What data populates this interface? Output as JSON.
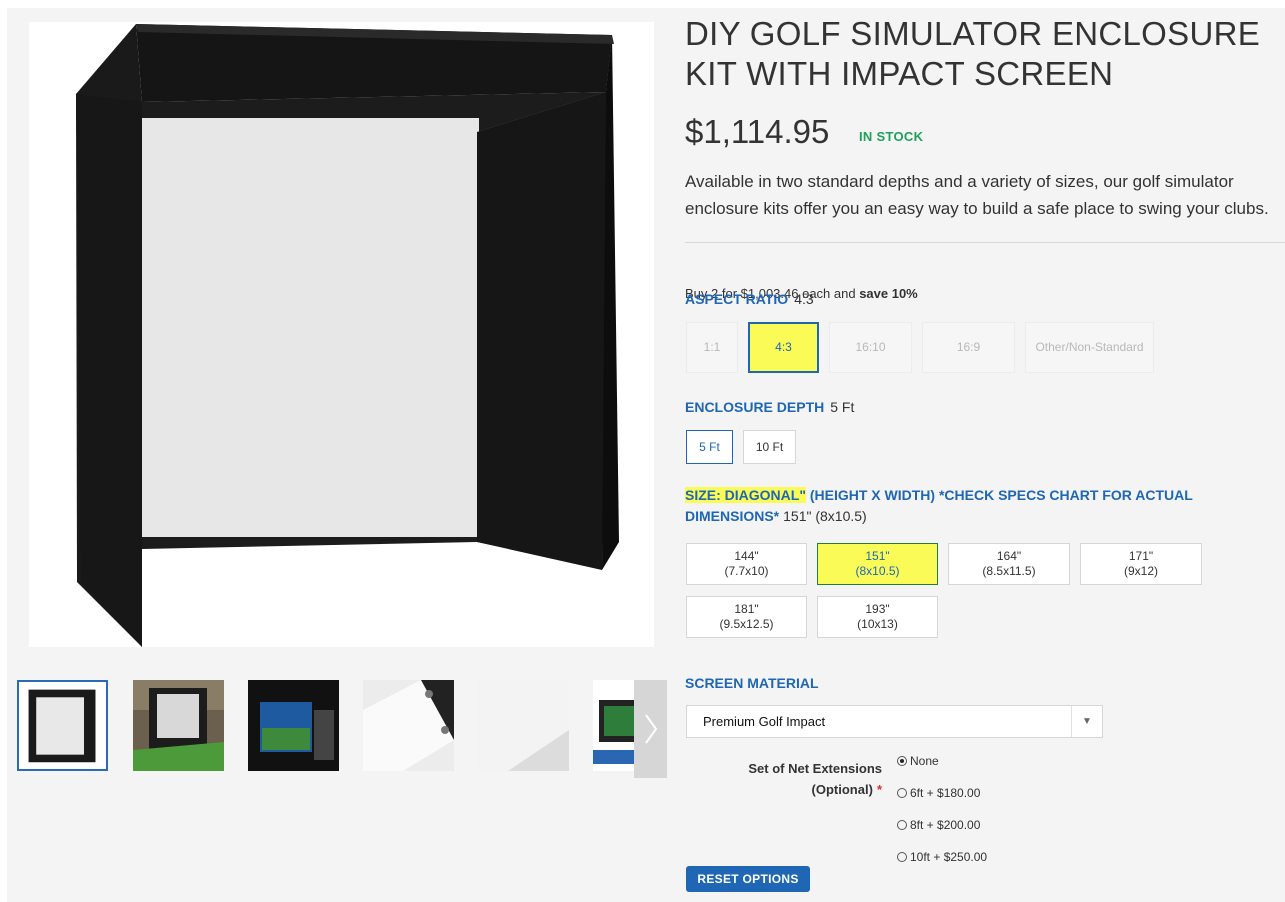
{
  "product": {
    "title": "DIY GOLF SIMULATOR ENCLOSURE KIT WITH IMPACT SCREEN",
    "price": "$1,114.95",
    "stock": "IN STOCK",
    "description": "Available in two standard depths and a variety of sizes, our golf simulator enclosure kits offer you an easy way to build a safe place to swing your clubs.",
    "tier_price": {
      "prefix": "Buy 2 for $1,003.46 each and ",
      "bold": "save 10%"
    }
  },
  "gallery": {
    "thumbnails": [
      "enclosure-front",
      "enclosure-room-turf",
      "enclosure-projection",
      "screen-corner-grommets",
      "screen-fabric-closeup",
      "enclosure-net-extension"
    ]
  },
  "aspect_ratio": {
    "label": "ASPECT RATIO",
    "selected": "4:3",
    "options": [
      "1:1",
      "4:3",
      "16:10",
      "16:9",
      "Other/Non-Standard"
    ]
  },
  "depth": {
    "label": "ENCLOSURE DEPTH",
    "selected": "5 Ft",
    "options": [
      "5 Ft",
      "10 Ft"
    ]
  },
  "size": {
    "label_highlight": "SIZE: DIAGONAL\"",
    "label_rest": " (HEIGHT X WIDTH) *CHECK SPECS CHART FOR ACTUAL DIMENSIONS*",
    "selected": "151\" (8x10.5)",
    "options": [
      {
        "diag": "144\"",
        "dims": "(7.7x10)"
      },
      {
        "diag": "151\"",
        "dims": "(8x10.5)"
      },
      {
        "diag": "164\"",
        "dims": "(8.5x11.5)"
      },
      {
        "diag": "171\"",
        "dims": "(9x12)"
      },
      {
        "diag": "181\"",
        "dims": "(9.5x12.5)"
      },
      {
        "diag": "193\"",
        "dims": "(10x13)"
      }
    ]
  },
  "screen_material": {
    "label": "SCREEN MATERIAL",
    "value": "Premium Golf Impact"
  },
  "net_extensions": {
    "label_line1": "Set of Net Extensions",
    "label_line2": "(Optional)",
    "required_mark": "*",
    "options": [
      "None",
      "6ft + $180.00",
      "8ft + $200.00",
      "10ft + $250.00"
    ],
    "selected": "None"
  },
  "reset_label": "RESET OPTIONS",
  "colors": {
    "accent": "#1f66b4",
    "highlight": "#fbfb58",
    "in_stock": "#1ea25a",
    "required": "#e02b27"
  }
}
